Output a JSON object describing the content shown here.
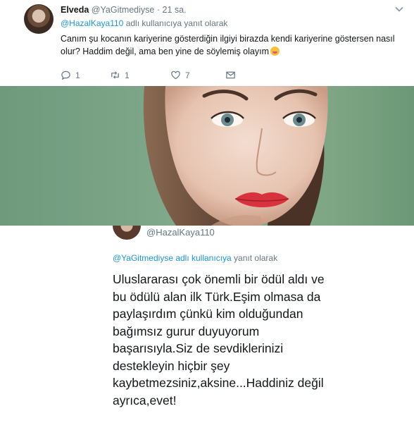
{
  "tweet": {
    "name": "Elveda",
    "handle": "@YaGitmediyse",
    "separator": "·",
    "time": "21 sa.",
    "reply_mention": "@HazalKaya110",
    "reply_suffix": "adlı kullanıcıya yanıt olarak",
    "text": "Canım şu kocanın kariyerine gösterdiğin ilgiyi birazda kendi kariyerine göstersen nasıl olur? Haddim değil, ama ben yine de söylemiş olayım",
    "actions": {
      "reply_count": "1",
      "retweet_count": "1",
      "like_count": "7"
    }
  },
  "reply_tweet": {
    "handle": "@HazalKaya110",
    "reply_mention": "@YaGitmediyse adlı kullanıcıya",
    "reply_suffix": "yanıt olarak",
    "text": "Uluslararası çok önemli bir ödül aldı ve bu ödülü alan ilk Türk.Eşim olmasa da paylaşırdım çünkü kim olduğundan bağımsız gurur duyuyorum başarısıyla.Siz de sevdiklerinizi destekleyin hiçbir şey kaybetmezsiniz,aksine...Haddiniz değil ayrıca,evet!"
  },
  "colors": {
    "link": "#1b95e0",
    "muted": "#657786",
    "text": "#14171a",
    "photo_background": "#7ba487",
    "lips": "#d8323e"
  },
  "icons": [
    "chevron-down-icon",
    "reply-icon",
    "retweet-icon",
    "like-icon",
    "message-icon",
    "emoji-icon"
  ]
}
